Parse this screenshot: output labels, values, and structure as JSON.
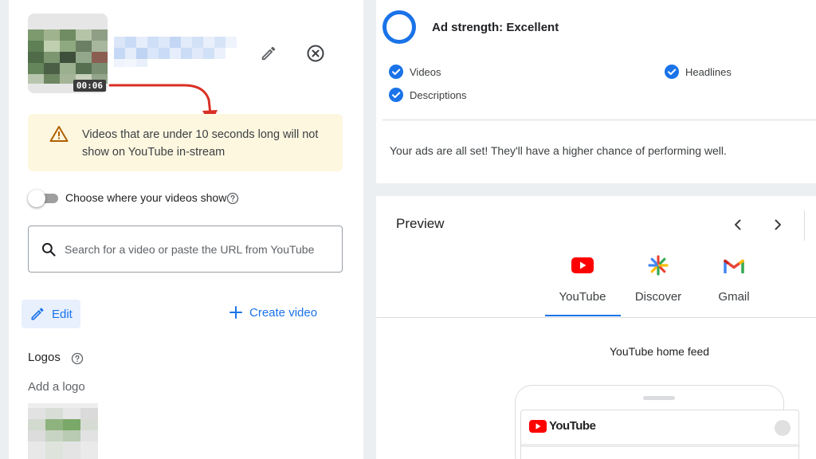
{
  "video": {
    "duration": "00:06"
  },
  "warning": {
    "text": "Videos that are under 10 seconds long will not show on YouTube in-stream"
  },
  "placement": {
    "toggle_label": "Choose where your videos show",
    "toggle_on": false
  },
  "search": {
    "placeholder": "Search for a video or paste the URL from YouTube",
    "value": ""
  },
  "actions": {
    "edit_label": "Edit",
    "create_label": "Create video"
  },
  "logos": {
    "title": "Logos",
    "add_label": "Add a logo"
  },
  "ad_strength": {
    "title": "Ad strength: Excellent",
    "checks": [
      "Videos",
      "Descriptions",
      "Headlines"
    ],
    "message": "Your ads are all set! They'll have a higher chance of performing well."
  },
  "preview": {
    "title": "Preview",
    "tabs": [
      {
        "label": "YouTube",
        "icon": "youtube-icon",
        "selected": true
      },
      {
        "label": "Discover",
        "icon": "discover-icon",
        "selected": false
      },
      {
        "label": "Gmail",
        "icon": "gmail-icon",
        "selected": false
      }
    ],
    "feed_label": "YouTube home feed",
    "app_logo_text": "YouTube"
  },
  "colors": {
    "accent": "#1a73e8",
    "warning_bg": "#fef7e0",
    "warning_icon": "#b06000",
    "youtube_red": "#ff0000",
    "arrow_red": "#d93025"
  }
}
